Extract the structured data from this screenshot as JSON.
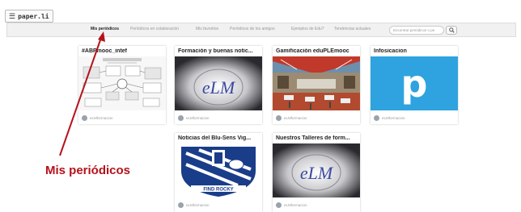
{
  "app": {
    "logo": "paper.li",
    "menu_icon": "hamburger-menu-icon"
  },
  "nav": {
    "links": [
      "Mis periódicos",
      "Periódicos en colaboración",
      "Mis favoritos",
      "Periódicos de los amigos",
      "Ejemplos de Edu?",
      "Tendencias actuales"
    ],
    "active_index": 0,
    "search_placeholder": "Encontrar periódicos o pe",
    "search_icon": "search-icon"
  },
  "cards": [
    {
      "title": "#ABPmooc_intef",
      "author": "eLMformacion"
    },
    {
      "title": "Formación y buenas notic...",
      "author": "eLMformacion"
    },
    {
      "title": "Gamificación eduPLEmooc",
      "author": "eLMformacion"
    },
    {
      "title": "Infosicacion",
      "author": "eLMformacion"
    },
    {
      "title": "Noticias del Blu-Sens Vig...",
      "author": "eLMformacion"
    },
    {
      "title": "Nuestros Talleres de form...",
      "author": "eLMformacion"
    }
  ],
  "image_text": {
    "elm": "eLM",
    "crest_bottom": "FIND ROCKY",
    "paperli_p": "p"
  },
  "annotation": {
    "label": "Mis periódicos",
    "color": "#b5121b"
  },
  "colors": {
    "paperli_blue": "#2ea3df",
    "crest_blue": "#1a3d8a",
    "annotation_red": "#b5121b"
  }
}
